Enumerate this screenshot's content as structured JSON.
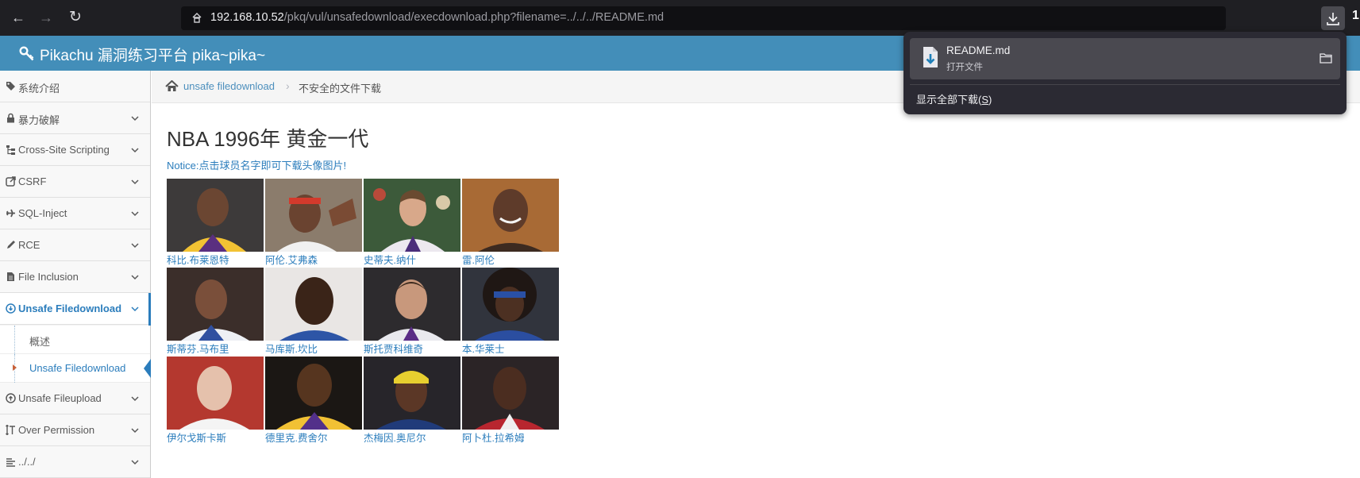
{
  "browser": {
    "back_icon": "←",
    "forward_icon": "→",
    "reload_icon": "↻",
    "url_host": "192.168.10.52",
    "url_path": "/pkq/vul/unsafedownload/execdownload.php?filename=../../../README.md",
    "edge_glyph": "1"
  },
  "site": {
    "title": "Pikachu 漏洞练习平台 pika~pika~"
  },
  "sidebar": {
    "items": [
      {
        "label": "系统介绍",
        "icon": "tags-icon"
      },
      {
        "label": "暴力破解",
        "icon": "lock-icon"
      },
      {
        "label": "Cross-Site Scripting",
        "icon": "sitemap-icon"
      },
      {
        "label": "CSRF",
        "icon": "share-icon"
      },
      {
        "label": "SQL-Inject",
        "icon": "plane-icon"
      },
      {
        "label": "RCE",
        "icon": "pencil-icon"
      },
      {
        "label": "File Inclusion",
        "icon": "file-icon"
      },
      {
        "label": "Unsafe Filedownload",
        "icon": "download-circle-icon"
      },
      {
        "label": "Unsafe Fileupload",
        "icon": "upload-circle-icon"
      },
      {
        "label": "Over Permission",
        "icon": "text-height-icon"
      },
      {
        "label": "../../",
        "icon": "align-left-icon"
      }
    ],
    "subitems": [
      {
        "label": "概述"
      },
      {
        "label": "Unsafe Filedownload"
      }
    ]
  },
  "breadcrumb": {
    "home_icon": "home-icon",
    "crumb1": "unsafe filedownload",
    "separator": "›",
    "crumb2": "不安全的文件下载"
  },
  "main": {
    "heading": "NBA 1996年 黄金一代",
    "notice": "Notice:点击球员名字即可下载头像图片!",
    "players": [
      {
        "name": "科比.布莱恩特"
      },
      {
        "name": "阿伦.艾弗森"
      },
      {
        "name": "史蒂夫.纳什"
      },
      {
        "name": "雷.阿伦"
      },
      {
        "name": "斯蒂芬.马布里"
      },
      {
        "name": "马库斯.坎比"
      },
      {
        "name": "斯托贾科维奇"
      },
      {
        "name": "本.华莱士"
      },
      {
        "name": "伊尔戈斯卡斯"
      },
      {
        "name": "德里克.费舍尔"
      },
      {
        "name": "杰梅因.奥尼尔"
      },
      {
        "name": "阿卜杜.拉希姆"
      }
    ]
  },
  "downloads": {
    "file_name": "README.md",
    "file_status": "打开文件",
    "show_all_prefix": "显示全部下载(",
    "show_all_key": "S",
    "show_all_suffix": ")"
  },
  "colors": {
    "header_blue": "#438eb9",
    "link_blue": "#2b7dbc",
    "toolbar": "#1f1f23",
    "panel": "#2b2a33"
  }
}
